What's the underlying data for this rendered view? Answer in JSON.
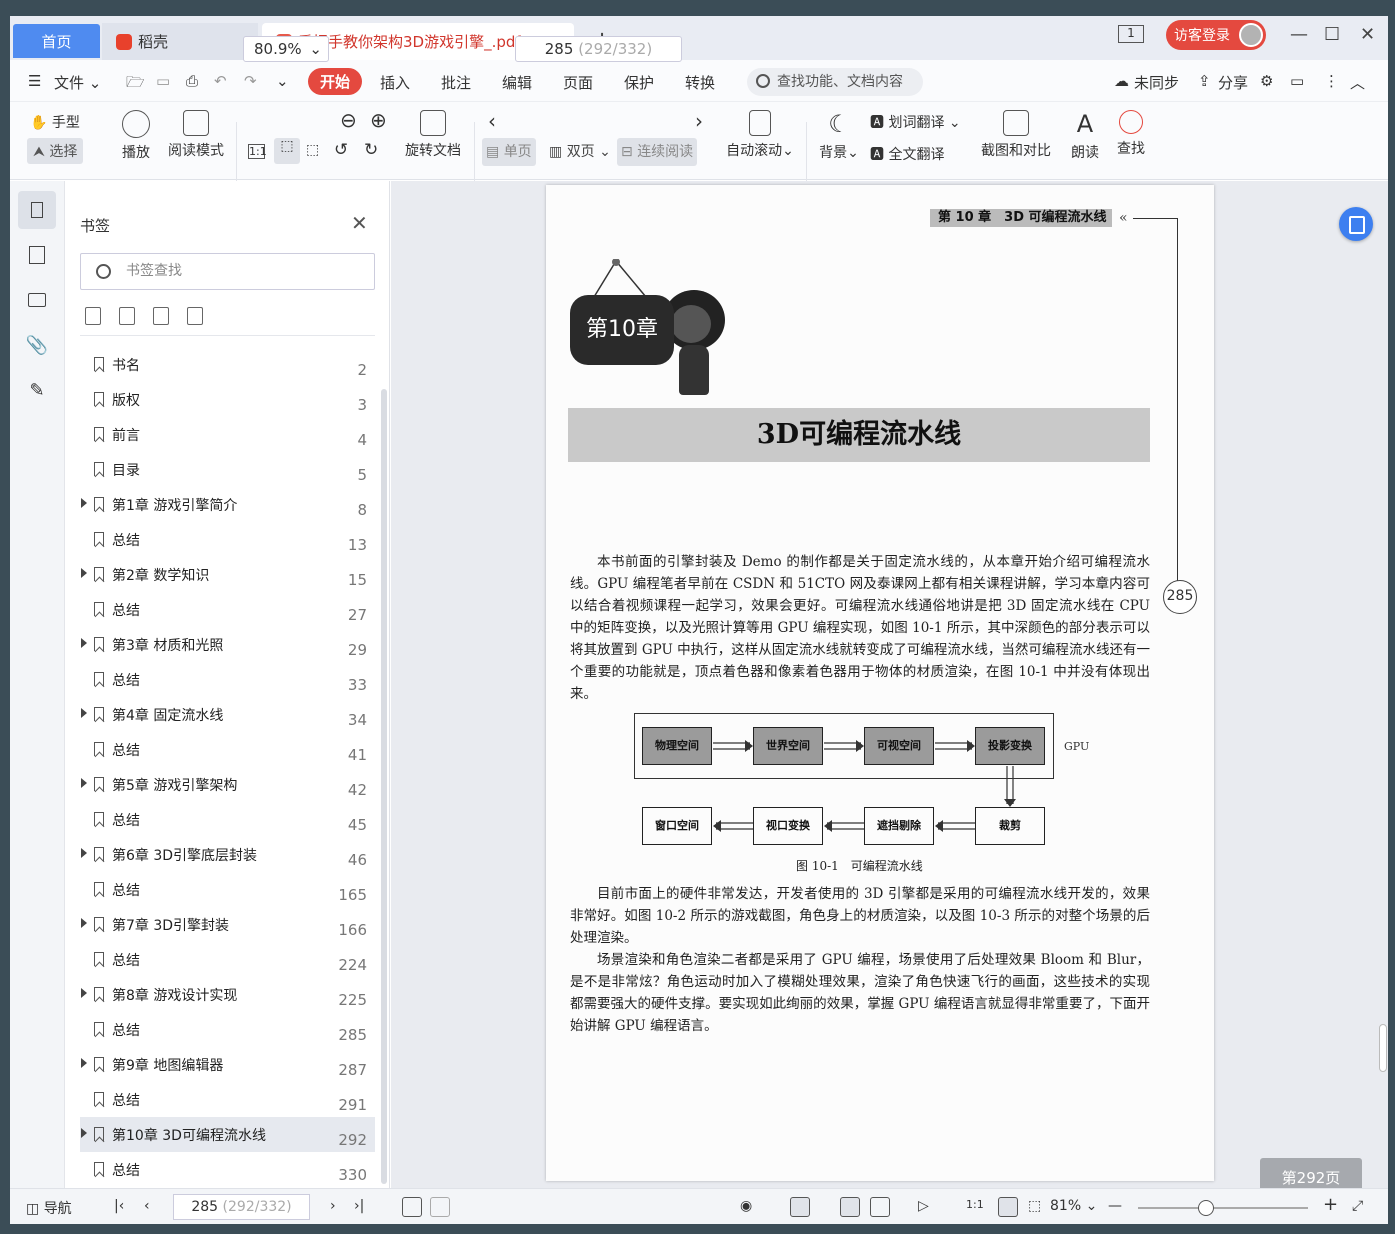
{
  "tabs": {
    "home": "首页",
    "daoke": "稻壳",
    "pdf": "手把手教你架构3D游戏引擎_.pdf",
    "add": "+"
  },
  "window": {
    "page_badge": "1",
    "login": "访客登录",
    "minimize": "—",
    "maximize": "☐",
    "close": "✕"
  },
  "menu": {
    "file": "文件",
    "items": [
      "开始",
      "插入",
      "批注",
      "编辑",
      "页面",
      "保护",
      "转换"
    ],
    "search": "查找功能、文档内容",
    "sync": "未同步",
    "share": "分享"
  },
  "toolbar": {
    "hand": "手型",
    "select": "选择",
    "play": "播放",
    "read_mode": "阅读模式",
    "zoom": "80.9%",
    "rotate": "旋转文档",
    "page_current": "285",
    "page_total": "(292/332)",
    "single": "单页",
    "double": "双页",
    "continuous": "连续阅读",
    "auto_scroll": "自动滚动",
    "background": "背景",
    "word_translate": "划词翻译",
    "full_translate": "全文翻译",
    "screenshot": "截图和对比",
    "read_aloud": "朗读",
    "find": "查找"
  },
  "bookmark": {
    "title": "书签",
    "search_placeholder": "书签查找",
    "items": [
      {
        "label": "书名",
        "page": "2",
        "expand": false
      },
      {
        "label": "版权",
        "page": "3",
        "expand": false
      },
      {
        "label": "前言",
        "page": "4",
        "expand": false
      },
      {
        "label": "目录",
        "page": "5",
        "expand": false
      },
      {
        "label": "第1章 游戏引擎简介",
        "page": "8",
        "expand": true
      },
      {
        "label": "总结",
        "page": "13",
        "expand": false
      },
      {
        "label": "第2章 数学知识",
        "page": "15",
        "expand": true
      },
      {
        "label": "总结",
        "page": "27",
        "expand": false
      },
      {
        "label": "第3章 材质和光照",
        "page": "29",
        "expand": true
      },
      {
        "label": "总结",
        "page": "33",
        "expand": false
      },
      {
        "label": "第4章 固定流水线",
        "page": "34",
        "expand": true
      },
      {
        "label": "总结",
        "page": "41",
        "expand": false
      },
      {
        "label": "第5章 游戏引擎架构",
        "page": "42",
        "expand": true
      },
      {
        "label": "总结",
        "page": "45",
        "expand": false
      },
      {
        "label": "第6章 3D引擎底层封装",
        "page": "46",
        "expand": true
      },
      {
        "label": "总结",
        "page": "165",
        "expand": false
      },
      {
        "label": "第7章 3D引擎封装",
        "page": "166",
        "expand": true
      },
      {
        "label": "总结",
        "page": "224",
        "expand": false
      },
      {
        "label": "第8章 游戏设计实现",
        "page": "225",
        "expand": true
      },
      {
        "label": "总结",
        "page": "285",
        "expand": false
      },
      {
        "label": "第9章 地图编辑器",
        "page": "287",
        "expand": true
      },
      {
        "label": "总结",
        "page": "291",
        "expand": false
      },
      {
        "label": "第10章 3D可编程流水线",
        "page": "292",
        "expand": true
      },
      {
        "label": "总结",
        "page": "330",
        "expand": false
      }
    ]
  },
  "doc": {
    "chapter_header": "第 10 章　3D 可编程流水线",
    "page_number": "285",
    "chapter_sign": "第10章",
    "title": "3D可编程流水线",
    "para1": "本书前面的引擎封装及 Demo 的制作都是关于固定流水线的，从本章开始介绍可编程流水线。GPU 编程笔者早前在 CSDN 和 51CTO 网及泰课网上都有相关课程讲解，学习本章内容可以结合着视频课程一起学习，效果会更好。可编程流水线通俗地讲是把 3D 固定流水线在 CPU 中的矩阵变换，以及光照计算等用 GPU 编程实现，如图 10-1 所示，其中深颜色的部分表示可以将其放置到 GPU 中执行，这样从固定流水线就转变成了可编程流水线，当然可编程流水线还有一个重要的功能就是，顶点着色器和像素着色器用于物体的材质渲染，在图 10-1 中并没有体现出来。",
    "fig_top": [
      "物理空间",
      "世界空间",
      "可视空间",
      "投影变换"
    ],
    "fig_bottom": [
      "窗口空间",
      "视口变换",
      "遮挡剔除",
      "裁剪"
    ],
    "fig_gpu": "GPU",
    "fig_caption": "图 10-1　可编程流水线",
    "para2": "目前市面上的硬件非常发达，开发者使用的 3D 引擎都是采用的可编程流水线开发的，效果非常好。如图 10-2 所示的游戏截图，角色身上的材质渲染，以及图 10-3 所示的对整个场景的后处理渲染。",
    "para3": "场景渲染和角色渲染二者都是采用了 GPU 编程，场景使用了后处理效果 Bloom 和 Blur，是不是非常炫？角色运动时加入了模糊处理效果，渲染了角色快速飞行的画面，这些技术的实现都需要强大的硬件支撑。要实现如此绚丽的效果，掌握 GPU 编程语言就显得非常重要了，下面开始讲解 GPU 编程语言。",
    "page_tag": "第292页"
  },
  "status": {
    "nav": "导航",
    "page_current": "285",
    "page_total": "(292/332)",
    "zoom": "81%",
    "minus": "—",
    "plus": "+"
  }
}
